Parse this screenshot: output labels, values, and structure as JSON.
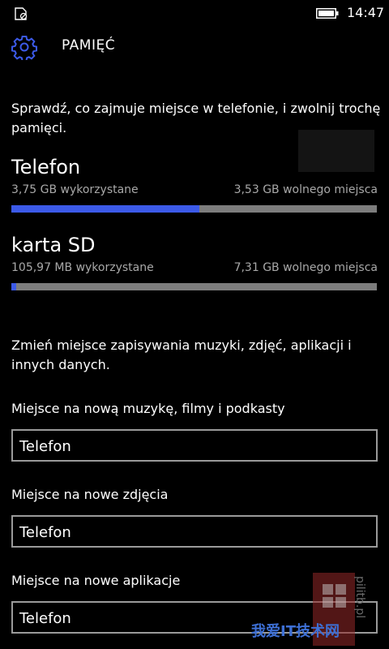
{
  "status_bar": {
    "time": "14:47",
    "icons": {
      "left": "no-sim-icon",
      "battery": "battery-icon"
    }
  },
  "header": {
    "title": "PAMIĘĆ",
    "icon": "gear-icon"
  },
  "intro": {
    "text": "Sprawdź, co zajmuje miejsce w telefonie, i zwolnij trochę pamięci."
  },
  "drives": [
    {
      "name": "Telefon",
      "used": "3,75 GB wykorzystane",
      "free": "3,53 GB wolnego miejsca",
      "used_fraction": 0.515
    },
    {
      "name": "karta SD",
      "used": "105,97 MB wykorzystane",
      "free": "7,31 GB wolnego miejsca",
      "used_fraction": 0.014
    }
  ],
  "save_locations": {
    "description": "Zmień miejsce zapisywania muzyki, zdjęć, aplikacji i innych danych.",
    "fields": [
      {
        "label": "Miejsce na nową muzykę, filmy i podkasty",
        "value": "Telefon"
      },
      {
        "label": "Miejsce na nowe zdjęcia",
        "value": "Telefon"
      },
      {
        "label": "Miejsce na nowe aplikacje",
        "value": "Telefon"
      }
    ]
  },
  "watermark": {
    "text": "我爱IT技术网",
    "side_text": "pilitb.pl"
  },
  "colors": {
    "accent": "#3c5ae8",
    "background": "#000000",
    "bar_track": "#7d7d7d",
    "secondary_text": "#a8a8a8"
  }
}
